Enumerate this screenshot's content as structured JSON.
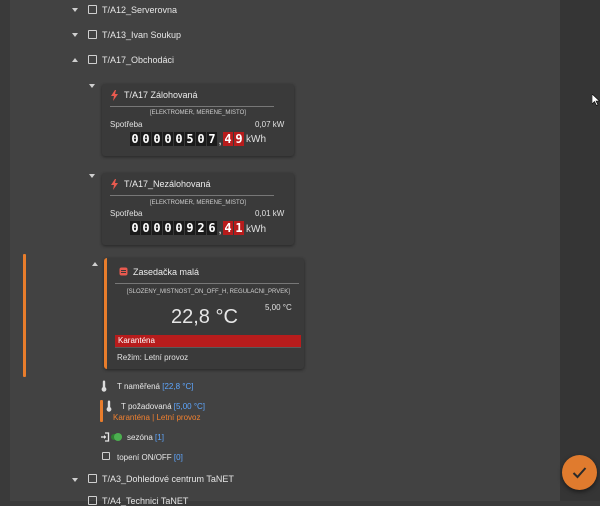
{
  "tree": {
    "items": [
      {
        "label": "T/A12_Serverovna",
        "state": "collapsed"
      },
      {
        "label": "T/A13_Ivan Soukup",
        "state": "collapsed"
      },
      {
        "label": "T/A17_Obchodáci",
        "state": "expanded"
      },
      {
        "label": "T/A3_Dohledové centrum TaNET",
        "state": "collapsed"
      },
      {
        "label": "T/A4_Technici TaNET",
        "state": "collapsed"
      }
    ]
  },
  "meters": [
    {
      "title": "T/A17 Zálohovaná",
      "tag": "[ELEKTROMER, MERENE_MISTO]",
      "consumption_label": "Spotřeba",
      "power": "0,07 kW",
      "digits_int": [
        "0",
        "0",
        "0",
        "0",
        "0",
        "5",
        "0",
        "7"
      ],
      "digits_dec": [
        "4",
        "9"
      ],
      "unit": "kWh"
    },
    {
      "title": "T/A17_Nezálohovaná",
      "tag": "[ELEKTROMER, MERENE_MISTO]",
      "consumption_label": "Spotřeba",
      "power": "0,01 kW",
      "digits_int": [
        "0",
        "0",
        "0",
        "0",
        "0",
        "9",
        "2",
        "6"
      ],
      "digits_dec": [
        "4",
        "1"
      ],
      "unit": "kWh"
    }
  ],
  "room": {
    "title": "Zasedačka malá",
    "tag": "[SLOZENY_MISTNOST_ON_OFF_H, REGULACNI_PRVEK]",
    "temperature": "22,8 °C",
    "setpoint": "5,00 °C",
    "alert": "Karanténa",
    "mode": "Režim: Letní provoz"
  },
  "props": {
    "measured_label": "T naměřená",
    "measured_value": "[22,8 °C]",
    "required_label": "T požadovaná",
    "required_value": "[5,00 °C]",
    "required_sub": "Karanténa | Letní provoz",
    "season_label": "sezóna",
    "season_value": "[1]",
    "heating_label": "topení ON/OFF",
    "heating_value": "[0]"
  },
  "colors": {
    "accent": "#e87d2c",
    "alert_red": "#b71c1c",
    "value_blue": "#5ea7ff",
    "fab": "#e07b2e"
  }
}
